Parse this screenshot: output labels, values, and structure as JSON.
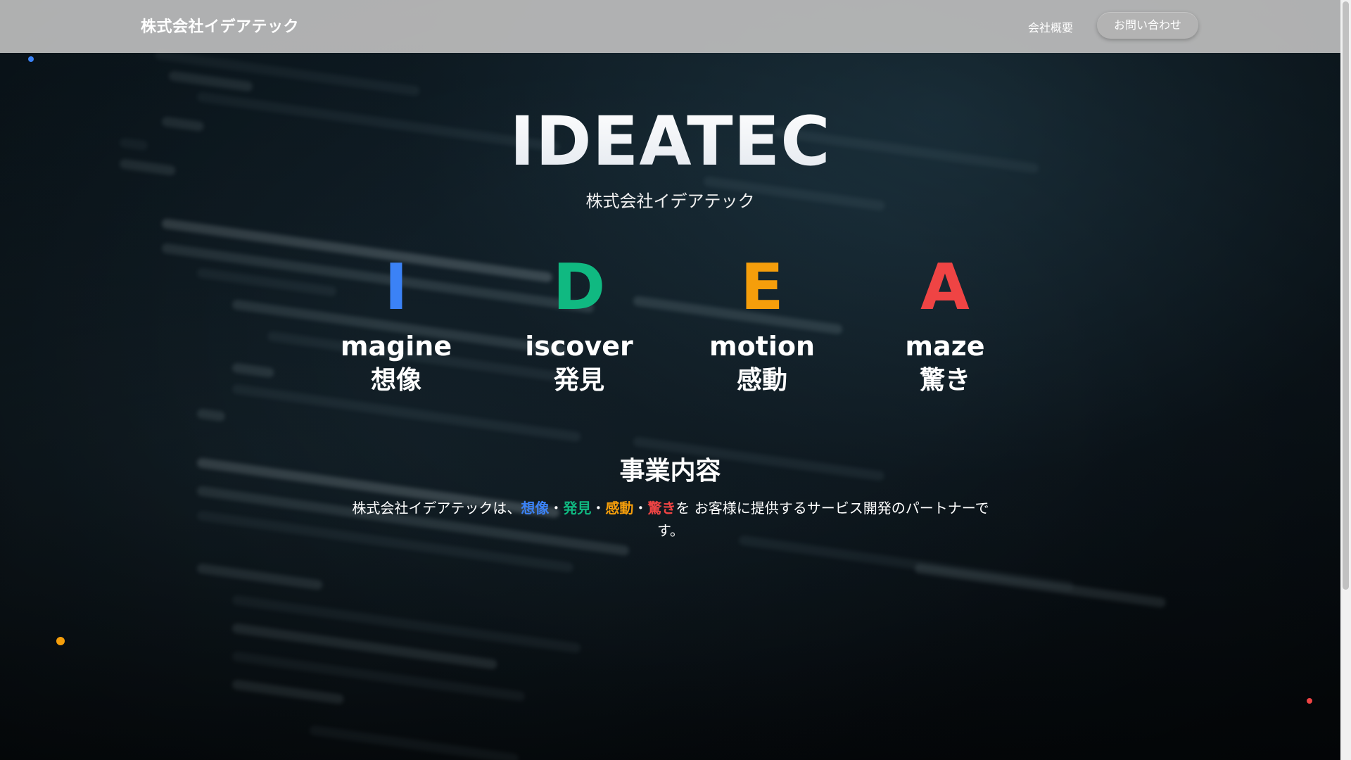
{
  "header": {
    "brand": "株式会社イデアテック",
    "nav_link": "会社概要",
    "cta_label": "お問い合わせ"
  },
  "hero": {
    "title": "IDEATEC",
    "subtitle": "株式会社イデアテック"
  },
  "pillars": [
    {
      "letter": "I",
      "word": "magine",
      "ja": "想像",
      "color": "#3b82f6"
    },
    {
      "letter": "D",
      "word": "iscover",
      "ja": "発見",
      "color": "#10b981"
    },
    {
      "letter": "E",
      "word": "motion",
      "ja": "感動",
      "color": "#f59e0b"
    },
    {
      "letter": "A",
      "word": "maze",
      "ja": "驚き",
      "color": "#ef4444"
    }
  ],
  "business": {
    "title": "事業内容",
    "intro": "株式会社イデアテックは、",
    "kw1": "想像",
    "sep1": "・",
    "kw2": "発見",
    "sep2": "・",
    "kw3": "感動",
    "sep3": "・",
    "kw4": "驚き",
    "outro": "を お客様に提供するサービス開発のパートナーです。"
  },
  "decor_colors": {
    "blue": "#3b82f6",
    "orange": "#f59e0b",
    "red": "#ef4444"
  }
}
